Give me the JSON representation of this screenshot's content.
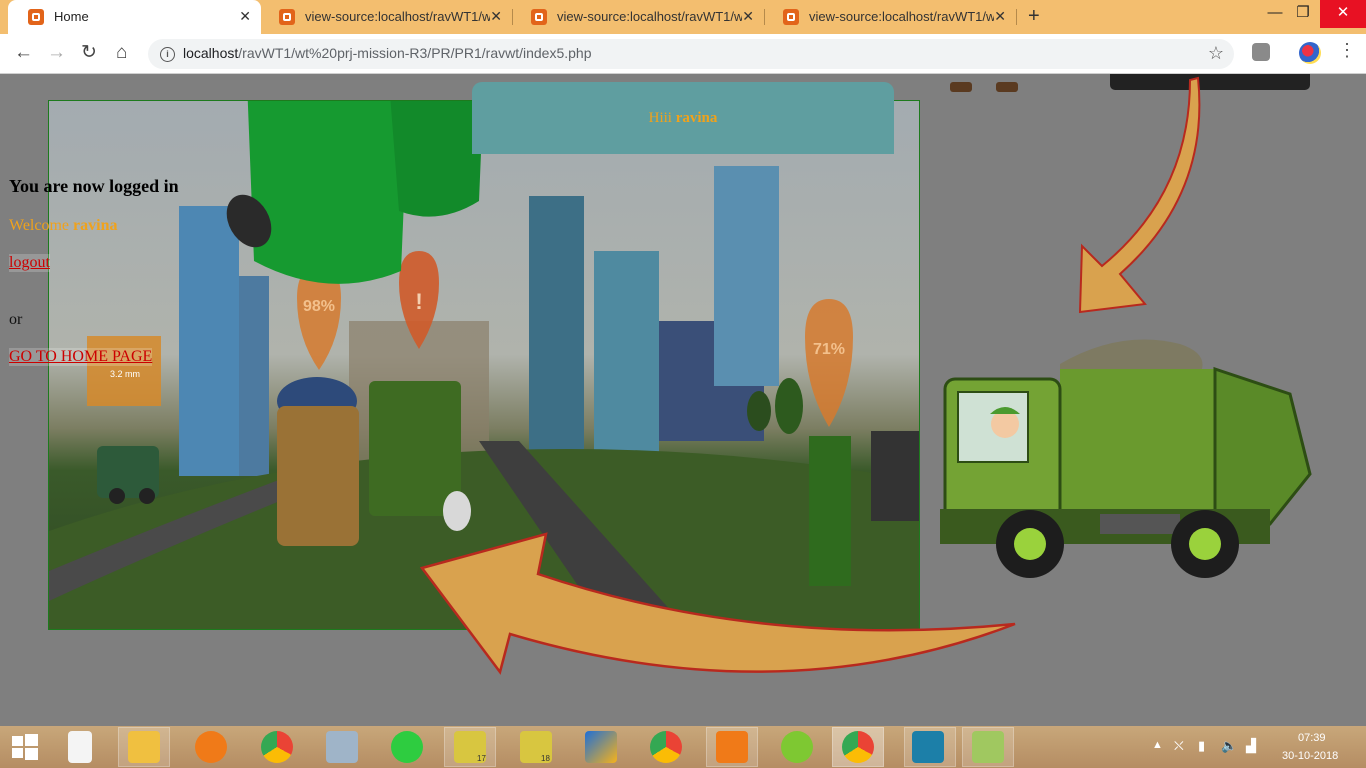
{
  "browser": {
    "tabs": [
      {
        "label": "Home",
        "active": true
      },
      {
        "label": "view-source:localhost/ravWT1/wt",
        "active": false
      },
      {
        "label": "view-source:localhost/ravWT1/wt",
        "active": false
      },
      {
        "label": "view-source:localhost/ravWT1/wt",
        "active": false
      }
    ],
    "new_tab": "+",
    "url_host": "localhost",
    "url_path": "/ravWT1/wt%20prj-mission-R3/PR/PR1/ravwt/index5.php",
    "window_controls": {
      "minimize": "—",
      "maximize": "❐",
      "close": "✕"
    }
  },
  "page": {
    "header_greeting": "Hiii",
    "username": "ravina",
    "logged_in_text": "You are now logged in",
    "welcome_text": "Welcome",
    "logout_label": "logout",
    "or_text": "or",
    "home_link_label": "GO TO HOME PAGE"
  },
  "scene_labels": {
    "badge_98": "98%",
    "badge_alert": "!",
    "badge_71": "71%",
    "sign_text": "3.2 mm"
  },
  "taskbar": {
    "time": "07:39",
    "date": "30-10-2018",
    "badge_17": "17",
    "badge_18": "18"
  },
  "colors": {
    "tab_strip": "#f3be6f",
    "header_box": "#5f9ea0",
    "greeting_text": "#f0a21b",
    "link_red": "#cc0000",
    "arrow_fill": "#d9a24e",
    "arrow_stroke": "#b8291e"
  }
}
